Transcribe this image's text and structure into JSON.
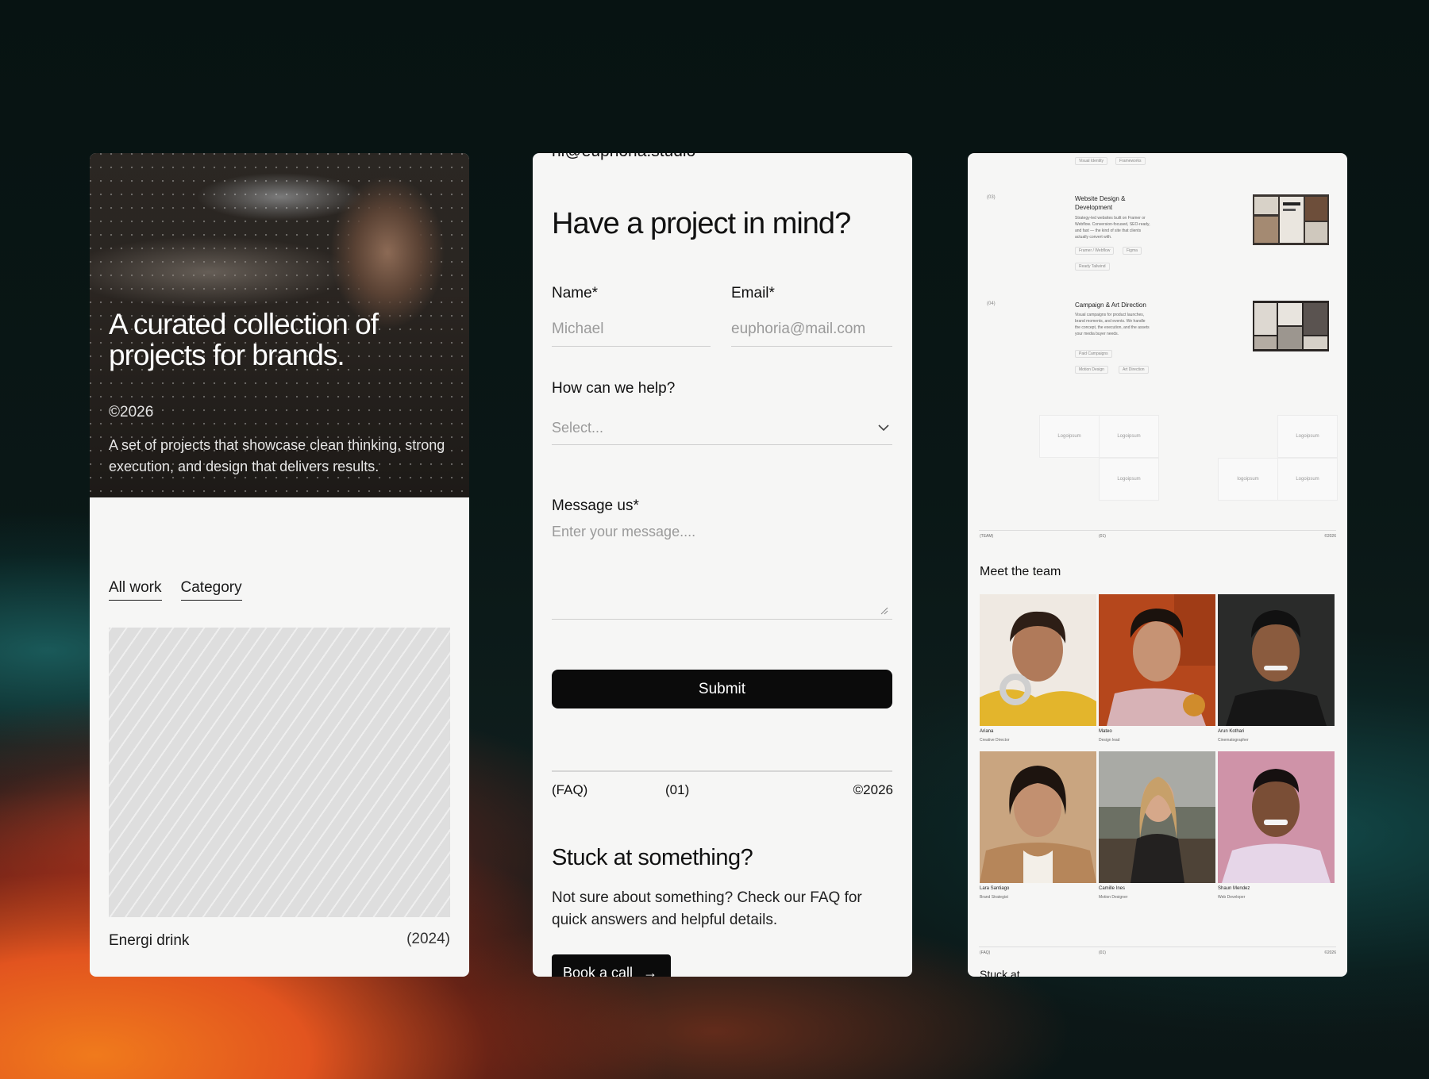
{
  "colors": {
    "panel_bg": "#f6f6f5",
    "button_bg": "#0b0b0b",
    "page_bg": "#0a1716"
  },
  "portfolio": {
    "hero_title": "A curated collection of projects for brands.",
    "year": "©2026",
    "description": "A set of projects that showcase clean thinking, strong execution, and design that delivers results.",
    "tabs": [
      "All work",
      "Category"
    ],
    "project": {
      "name": "Energi drink",
      "year": "(2024)"
    }
  },
  "contact": {
    "email_cut": "hi@euphoria.studio",
    "title": "Have a project in mind?",
    "name_label": "Name*",
    "name_placeholder": "Michael",
    "email_label": "Email*",
    "email_placeholder": "euphoria@mail.com",
    "help_label": "How can we help?",
    "help_select": "Select...",
    "message_label": "Message us*",
    "message_placeholder": "Enter your message....",
    "submit": "Submit",
    "faq_row": {
      "left": "(FAQ)",
      "mid": "(01)",
      "right": "©2026"
    },
    "stuck_title": "Stuck at something?",
    "stuck_desc": "Not sure about something? Check our FAQ for quick answers and helpful details.",
    "book_call": "Book a call",
    "book_call_icon": "→"
  },
  "studio": {
    "top_tags": [
      "Visual Identity",
      "Frameworks"
    ],
    "services": [
      {
        "num": "(03)",
        "title": "Website Design & Development",
        "desc": "Strategy-led websites built on Framer or Webflow. Conversion-focused, SEO-ready, and fast — the kind of site that clients actually convert with.",
        "tags": [
          "Framer / Webflow",
          "Figma",
          "Ready Tailwind"
        ]
      },
      {
        "num": "(04)",
        "title": "Campaign & Art Direction",
        "desc": "Visual campaigns for product launches, brand moments, and events. We handle the concept, the execution, and the assets your media buyer needs.",
        "tags": [
          "Paid Campaigns",
          "Motion Design",
          "Art Direction"
        ]
      }
    ],
    "logos": [
      "Logoipsum",
      "Logoipsum",
      "Logoipsum",
      "Logoipsum",
      "logoipsum",
      "Logoipsum"
    ],
    "meta_row": {
      "left": "(TEAM)",
      "mid": "(01)",
      "right": "©2026"
    },
    "team_title": "Meet the team",
    "team": [
      {
        "name": "Ariana",
        "role": "Creative Director"
      },
      {
        "name": "Mateo",
        "role": "Design lead"
      },
      {
        "name": "Arun Kothari",
        "role": "Cinematographer"
      },
      {
        "name": "Lara Santiago",
        "role": "Brand Strategist"
      },
      {
        "name": "Camille Ines",
        "role": "Motion Designer"
      },
      {
        "name": "Shaun Mendez",
        "role": "Web Developer"
      }
    ],
    "bottom_row": {
      "left": "(FAQ)",
      "mid": "(01)",
      "right": "©2026"
    },
    "bottom_cut": "Stuck at"
  }
}
